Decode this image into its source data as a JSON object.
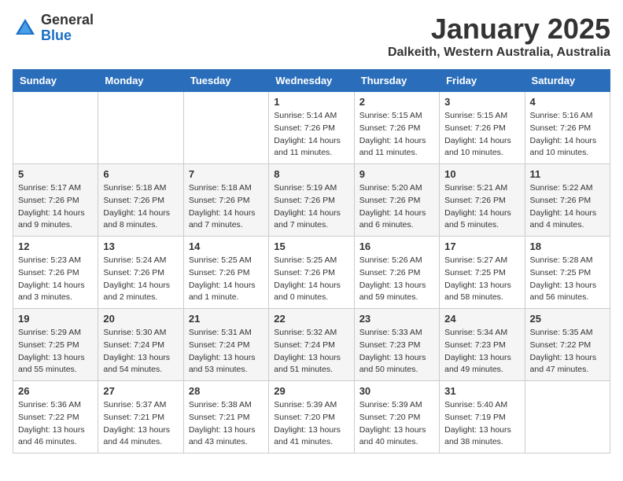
{
  "logo": {
    "general": "General",
    "blue": "Blue"
  },
  "title": "January 2025",
  "location": "Dalkeith, Western Australia, Australia",
  "days_header": [
    "Sunday",
    "Monday",
    "Tuesday",
    "Wednesday",
    "Thursday",
    "Friday",
    "Saturday"
  ],
  "weeks": [
    [
      {
        "day": "",
        "info": ""
      },
      {
        "day": "",
        "info": ""
      },
      {
        "day": "",
        "info": ""
      },
      {
        "day": "1",
        "info": "Sunrise: 5:14 AM\nSunset: 7:26 PM\nDaylight: 14 hours\nand 11 minutes."
      },
      {
        "day": "2",
        "info": "Sunrise: 5:15 AM\nSunset: 7:26 PM\nDaylight: 14 hours\nand 11 minutes."
      },
      {
        "day": "3",
        "info": "Sunrise: 5:15 AM\nSunset: 7:26 PM\nDaylight: 14 hours\nand 10 minutes."
      },
      {
        "day": "4",
        "info": "Sunrise: 5:16 AM\nSunset: 7:26 PM\nDaylight: 14 hours\nand 10 minutes."
      }
    ],
    [
      {
        "day": "5",
        "info": "Sunrise: 5:17 AM\nSunset: 7:26 PM\nDaylight: 14 hours\nand 9 minutes."
      },
      {
        "day": "6",
        "info": "Sunrise: 5:18 AM\nSunset: 7:26 PM\nDaylight: 14 hours\nand 8 minutes."
      },
      {
        "day": "7",
        "info": "Sunrise: 5:18 AM\nSunset: 7:26 PM\nDaylight: 14 hours\nand 7 minutes."
      },
      {
        "day": "8",
        "info": "Sunrise: 5:19 AM\nSunset: 7:26 PM\nDaylight: 14 hours\nand 7 minutes."
      },
      {
        "day": "9",
        "info": "Sunrise: 5:20 AM\nSunset: 7:26 PM\nDaylight: 14 hours\nand 6 minutes."
      },
      {
        "day": "10",
        "info": "Sunrise: 5:21 AM\nSunset: 7:26 PM\nDaylight: 14 hours\nand 5 minutes."
      },
      {
        "day": "11",
        "info": "Sunrise: 5:22 AM\nSunset: 7:26 PM\nDaylight: 14 hours\nand 4 minutes."
      }
    ],
    [
      {
        "day": "12",
        "info": "Sunrise: 5:23 AM\nSunset: 7:26 PM\nDaylight: 14 hours\nand 3 minutes."
      },
      {
        "day": "13",
        "info": "Sunrise: 5:24 AM\nSunset: 7:26 PM\nDaylight: 14 hours\nand 2 minutes."
      },
      {
        "day": "14",
        "info": "Sunrise: 5:25 AM\nSunset: 7:26 PM\nDaylight: 14 hours\nand 1 minute."
      },
      {
        "day": "15",
        "info": "Sunrise: 5:25 AM\nSunset: 7:26 PM\nDaylight: 14 hours\nand 0 minutes."
      },
      {
        "day": "16",
        "info": "Sunrise: 5:26 AM\nSunset: 7:26 PM\nDaylight: 13 hours\nand 59 minutes."
      },
      {
        "day": "17",
        "info": "Sunrise: 5:27 AM\nSunset: 7:25 PM\nDaylight: 13 hours\nand 58 minutes."
      },
      {
        "day": "18",
        "info": "Sunrise: 5:28 AM\nSunset: 7:25 PM\nDaylight: 13 hours\nand 56 minutes."
      }
    ],
    [
      {
        "day": "19",
        "info": "Sunrise: 5:29 AM\nSunset: 7:25 PM\nDaylight: 13 hours\nand 55 minutes."
      },
      {
        "day": "20",
        "info": "Sunrise: 5:30 AM\nSunset: 7:24 PM\nDaylight: 13 hours\nand 54 minutes."
      },
      {
        "day": "21",
        "info": "Sunrise: 5:31 AM\nSunset: 7:24 PM\nDaylight: 13 hours\nand 53 minutes."
      },
      {
        "day": "22",
        "info": "Sunrise: 5:32 AM\nSunset: 7:24 PM\nDaylight: 13 hours\nand 51 minutes."
      },
      {
        "day": "23",
        "info": "Sunrise: 5:33 AM\nSunset: 7:23 PM\nDaylight: 13 hours\nand 50 minutes."
      },
      {
        "day": "24",
        "info": "Sunrise: 5:34 AM\nSunset: 7:23 PM\nDaylight: 13 hours\nand 49 minutes."
      },
      {
        "day": "25",
        "info": "Sunrise: 5:35 AM\nSunset: 7:22 PM\nDaylight: 13 hours\nand 47 minutes."
      }
    ],
    [
      {
        "day": "26",
        "info": "Sunrise: 5:36 AM\nSunset: 7:22 PM\nDaylight: 13 hours\nand 46 minutes."
      },
      {
        "day": "27",
        "info": "Sunrise: 5:37 AM\nSunset: 7:21 PM\nDaylight: 13 hours\nand 44 minutes."
      },
      {
        "day": "28",
        "info": "Sunrise: 5:38 AM\nSunset: 7:21 PM\nDaylight: 13 hours\nand 43 minutes."
      },
      {
        "day": "29",
        "info": "Sunrise: 5:39 AM\nSunset: 7:20 PM\nDaylight: 13 hours\nand 41 minutes."
      },
      {
        "day": "30",
        "info": "Sunrise: 5:39 AM\nSunset: 7:20 PM\nDaylight: 13 hours\nand 40 minutes."
      },
      {
        "day": "31",
        "info": "Sunrise: 5:40 AM\nSunset: 7:19 PM\nDaylight: 13 hours\nand 38 minutes."
      },
      {
        "day": "",
        "info": ""
      }
    ]
  ]
}
